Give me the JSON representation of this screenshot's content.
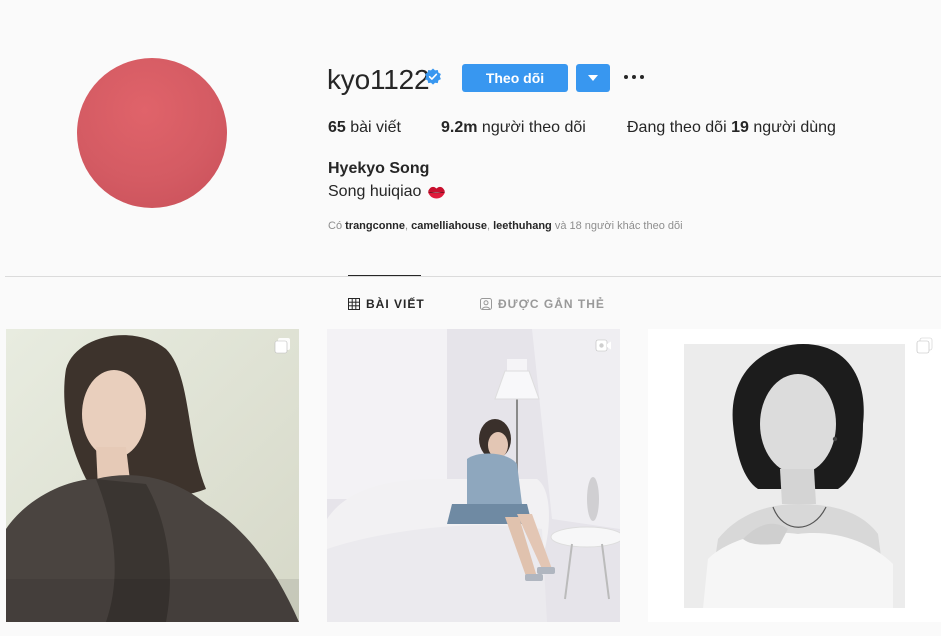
{
  "profile": {
    "username": "kyo1122",
    "verified_icon": "verified-badge-icon",
    "follow_label": "Theo dõi",
    "dropdown_icon": "caret-down-icon",
    "more_icon": "more-options-icon",
    "avatar_color": "#d45b63",
    "accent_color": "#3897f0"
  },
  "stats": {
    "posts_count": "65",
    "posts_label": "bài viết",
    "followers_count": "9.2m",
    "followers_label": "người theo dõi",
    "following_prefix": "Đang theo dõi",
    "following_count": "19",
    "following_suffix": "người dùng"
  },
  "bio": {
    "full_name": "Hyekyo Song",
    "text": "Song huiqiao",
    "emoji_icon": "kiss-lips-icon"
  },
  "followed_by": {
    "prefix": "Có",
    "user1": "trangconne",
    "sep1": ",",
    "user2": "camelliahouse",
    "sep2": ",",
    "user3": "leethuhang",
    "suffix": "và 18 người khác theo dõi"
  },
  "tabs": [
    {
      "label": "BÀI VIẾT",
      "icon": "grid-icon",
      "active": true
    },
    {
      "label": "ĐƯỢC GẮN THẺ",
      "icon": "tagged-person-icon",
      "active": false
    }
  ],
  "posts": [
    {
      "type": "carousel",
      "badge_icon": "multiple-photos-icon"
    },
    {
      "type": "video",
      "badge_icon": "video-icon"
    },
    {
      "type": "carousel",
      "badge_icon": "multiple-photos-icon"
    }
  ]
}
